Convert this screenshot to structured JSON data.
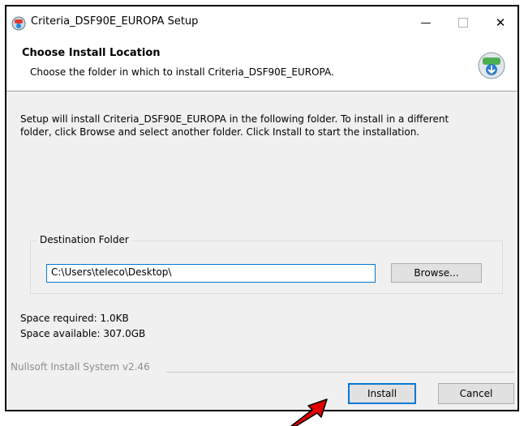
{
  "window": {
    "title": "Criteria_DSF90E_EUROPA Setup",
    "minimize_glyph": "—",
    "close_glyph": "✕"
  },
  "header": {
    "title": "Choose Install Location",
    "subtitle": "Choose the folder in which to install Criteria_DSF90E_EUROPA."
  },
  "body": {
    "intro_line1": "Setup will install Criteria_DSF90E_EUROPA in the following folder. To install in a different",
    "intro_line2": "folder, click Browse and select another folder. Click Install to start the installation."
  },
  "destination": {
    "group_label": "Destination Folder",
    "path_value": "C:\\Users\\teleco\\Desktop\\",
    "browse_label": "Browse..."
  },
  "space": {
    "required": "Space required: 1.0KB",
    "available": "Space available: 307.0GB"
  },
  "footer": {
    "branding": "Nullsoft Install System v2.46",
    "install_label": "Install",
    "cancel_label": "Cancel"
  },
  "colors": {
    "accent": "#0078d7",
    "annotation_arrow": "#e00000"
  },
  "icons": [
    "installer-app-icon",
    "installer-header-icon",
    "minimize-icon",
    "maximize-icon",
    "close-icon",
    "red-arrow-annotation"
  ]
}
